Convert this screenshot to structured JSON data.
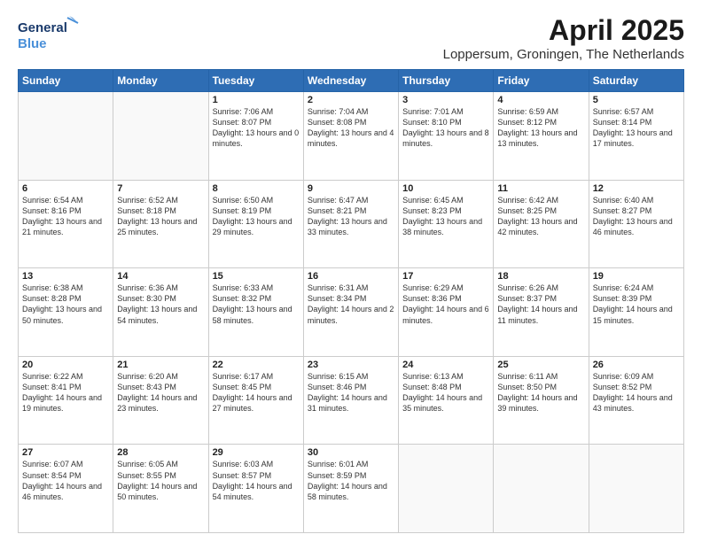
{
  "logo": {
    "line1": "General",
    "line2": "Blue"
  },
  "title": "April 2025",
  "subtitle": "Loppersum, Groningen, The Netherlands",
  "days_of_week": [
    "Sunday",
    "Monday",
    "Tuesday",
    "Wednesday",
    "Thursday",
    "Friday",
    "Saturday"
  ],
  "weeks": [
    [
      {
        "day": "",
        "info": ""
      },
      {
        "day": "",
        "info": ""
      },
      {
        "day": "1",
        "info": "Sunrise: 7:06 AM\nSunset: 8:07 PM\nDaylight: 13 hours and 0 minutes."
      },
      {
        "day": "2",
        "info": "Sunrise: 7:04 AM\nSunset: 8:08 PM\nDaylight: 13 hours and 4 minutes."
      },
      {
        "day": "3",
        "info": "Sunrise: 7:01 AM\nSunset: 8:10 PM\nDaylight: 13 hours and 8 minutes."
      },
      {
        "day": "4",
        "info": "Sunrise: 6:59 AM\nSunset: 8:12 PM\nDaylight: 13 hours and 13 minutes."
      },
      {
        "day": "5",
        "info": "Sunrise: 6:57 AM\nSunset: 8:14 PM\nDaylight: 13 hours and 17 minutes."
      }
    ],
    [
      {
        "day": "6",
        "info": "Sunrise: 6:54 AM\nSunset: 8:16 PM\nDaylight: 13 hours and 21 minutes."
      },
      {
        "day": "7",
        "info": "Sunrise: 6:52 AM\nSunset: 8:18 PM\nDaylight: 13 hours and 25 minutes."
      },
      {
        "day": "8",
        "info": "Sunrise: 6:50 AM\nSunset: 8:19 PM\nDaylight: 13 hours and 29 minutes."
      },
      {
        "day": "9",
        "info": "Sunrise: 6:47 AM\nSunset: 8:21 PM\nDaylight: 13 hours and 33 minutes."
      },
      {
        "day": "10",
        "info": "Sunrise: 6:45 AM\nSunset: 8:23 PM\nDaylight: 13 hours and 38 minutes."
      },
      {
        "day": "11",
        "info": "Sunrise: 6:42 AM\nSunset: 8:25 PM\nDaylight: 13 hours and 42 minutes."
      },
      {
        "day": "12",
        "info": "Sunrise: 6:40 AM\nSunset: 8:27 PM\nDaylight: 13 hours and 46 minutes."
      }
    ],
    [
      {
        "day": "13",
        "info": "Sunrise: 6:38 AM\nSunset: 8:28 PM\nDaylight: 13 hours and 50 minutes."
      },
      {
        "day": "14",
        "info": "Sunrise: 6:36 AM\nSunset: 8:30 PM\nDaylight: 13 hours and 54 minutes."
      },
      {
        "day": "15",
        "info": "Sunrise: 6:33 AM\nSunset: 8:32 PM\nDaylight: 13 hours and 58 minutes."
      },
      {
        "day": "16",
        "info": "Sunrise: 6:31 AM\nSunset: 8:34 PM\nDaylight: 14 hours and 2 minutes."
      },
      {
        "day": "17",
        "info": "Sunrise: 6:29 AM\nSunset: 8:36 PM\nDaylight: 14 hours and 6 minutes."
      },
      {
        "day": "18",
        "info": "Sunrise: 6:26 AM\nSunset: 8:37 PM\nDaylight: 14 hours and 11 minutes."
      },
      {
        "day": "19",
        "info": "Sunrise: 6:24 AM\nSunset: 8:39 PM\nDaylight: 14 hours and 15 minutes."
      }
    ],
    [
      {
        "day": "20",
        "info": "Sunrise: 6:22 AM\nSunset: 8:41 PM\nDaylight: 14 hours and 19 minutes."
      },
      {
        "day": "21",
        "info": "Sunrise: 6:20 AM\nSunset: 8:43 PM\nDaylight: 14 hours and 23 minutes."
      },
      {
        "day": "22",
        "info": "Sunrise: 6:17 AM\nSunset: 8:45 PM\nDaylight: 14 hours and 27 minutes."
      },
      {
        "day": "23",
        "info": "Sunrise: 6:15 AM\nSunset: 8:46 PM\nDaylight: 14 hours and 31 minutes."
      },
      {
        "day": "24",
        "info": "Sunrise: 6:13 AM\nSunset: 8:48 PM\nDaylight: 14 hours and 35 minutes."
      },
      {
        "day": "25",
        "info": "Sunrise: 6:11 AM\nSunset: 8:50 PM\nDaylight: 14 hours and 39 minutes."
      },
      {
        "day": "26",
        "info": "Sunrise: 6:09 AM\nSunset: 8:52 PM\nDaylight: 14 hours and 43 minutes."
      }
    ],
    [
      {
        "day": "27",
        "info": "Sunrise: 6:07 AM\nSunset: 8:54 PM\nDaylight: 14 hours and 46 minutes."
      },
      {
        "day": "28",
        "info": "Sunrise: 6:05 AM\nSunset: 8:55 PM\nDaylight: 14 hours and 50 minutes."
      },
      {
        "day": "29",
        "info": "Sunrise: 6:03 AM\nSunset: 8:57 PM\nDaylight: 14 hours and 54 minutes."
      },
      {
        "day": "30",
        "info": "Sunrise: 6:01 AM\nSunset: 8:59 PM\nDaylight: 14 hours and 58 minutes."
      },
      {
        "day": "",
        "info": ""
      },
      {
        "day": "",
        "info": ""
      },
      {
        "day": "",
        "info": ""
      }
    ]
  ]
}
